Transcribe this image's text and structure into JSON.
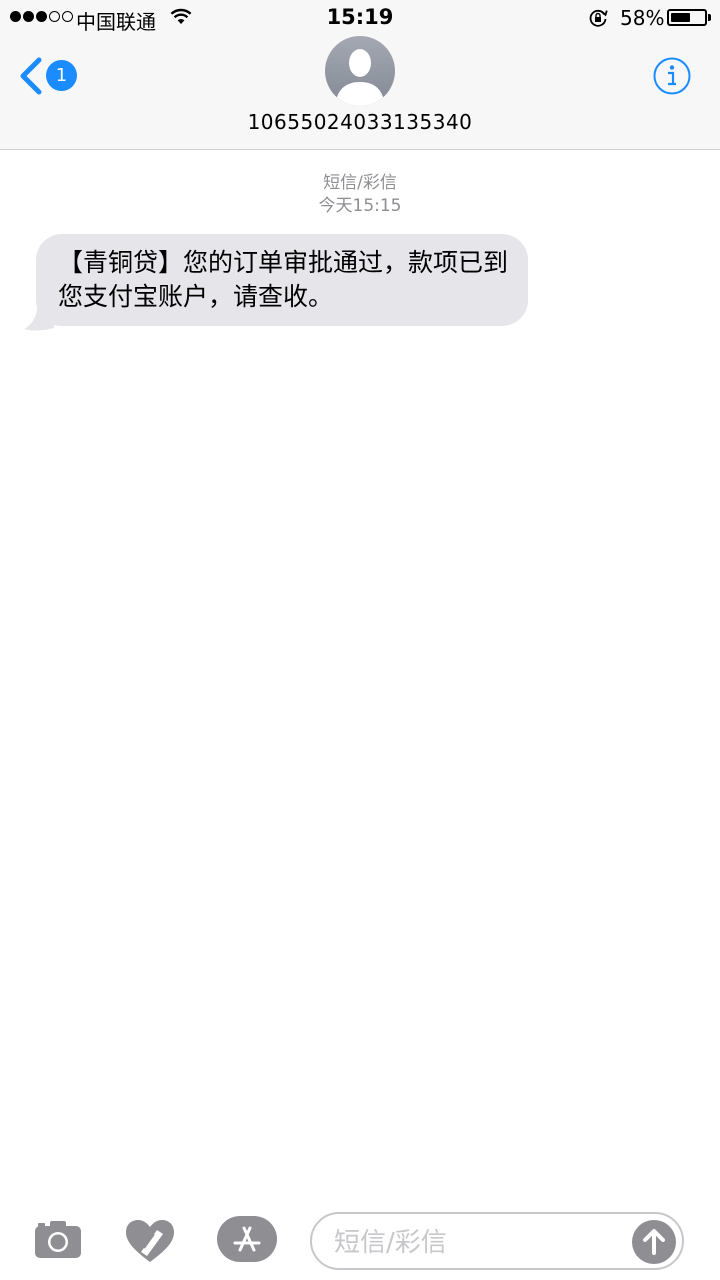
{
  "status_bar": {
    "carrier": "中国联通",
    "time": "15:19",
    "battery_percent": "58%",
    "battery_level": 0.58,
    "signal_bars_filled": 3,
    "signal_bars_total": 5
  },
  "header": {
    "back_badge": "1",
    "contact_number": "10655024033135340",
    "icons": {
      "back": "chevron-left-icon",
      "avatar": "person-silhouette-icon",
      "info": "info-circle-icon"
    }
  },
  "conversation": {
    "service_label": "短信/彩信",
    "timestamp": "今天15:15",
    "messages": [
      {
        "direction": "incoming",
        "text": "【青铜贷】您的订单审批通过，款项已到您支付宝账户，请查收。"
      }
    ]
  },
  "input_bar": {
    "placeholder": "短信/彩信",
    "icons": [
      "camera-icon",
      "digital-touch-heart-icon",
      "app-store-icon",
      "send-arrow-icon"
    ]
  },
  "colors": {
    "accent_blue": "#1a8cff",
    "bubble_gray": "#e5e5ea",
    "meta_gray": "#8e8e93",
    "bar_background": "#f7f7f7"
  }
}
